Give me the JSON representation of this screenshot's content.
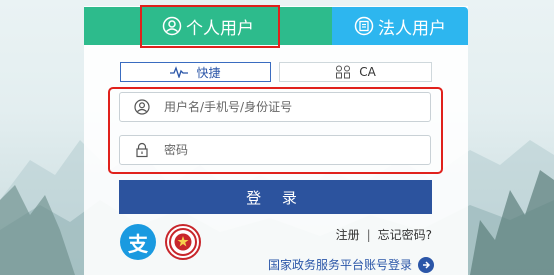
{
  "tabs": {
    "personal_label": "个人用户",
    "legal_label": "法人用户"
  },
  "login_modes": {
    "quick_label": "快捷",
    "ca_label": "CA"
  },
  "form": {
    "username_placeholder": "用户名/手机号/身份证号",
    "password_placeholder": "密码",
    "login_label": "登 录"
  },
  "alternative_login": {
    "alipay_icon_text": "支",
    "seal_icon": "gov-seal-icon"
  },
  "links": {
    "register": "注册",
    "separator": "|",
    "forgot_password": "忘记密码?",
    "gov_platform_login": "国家政务服务平台账号登录"
  },
  "colors": {
    "personal_tab": "#2dbb8c",
    "legal_tab": "#2db6ef",
    "login_button": "#2c539e",
    "highlight": "#e0211c"
  }
}
